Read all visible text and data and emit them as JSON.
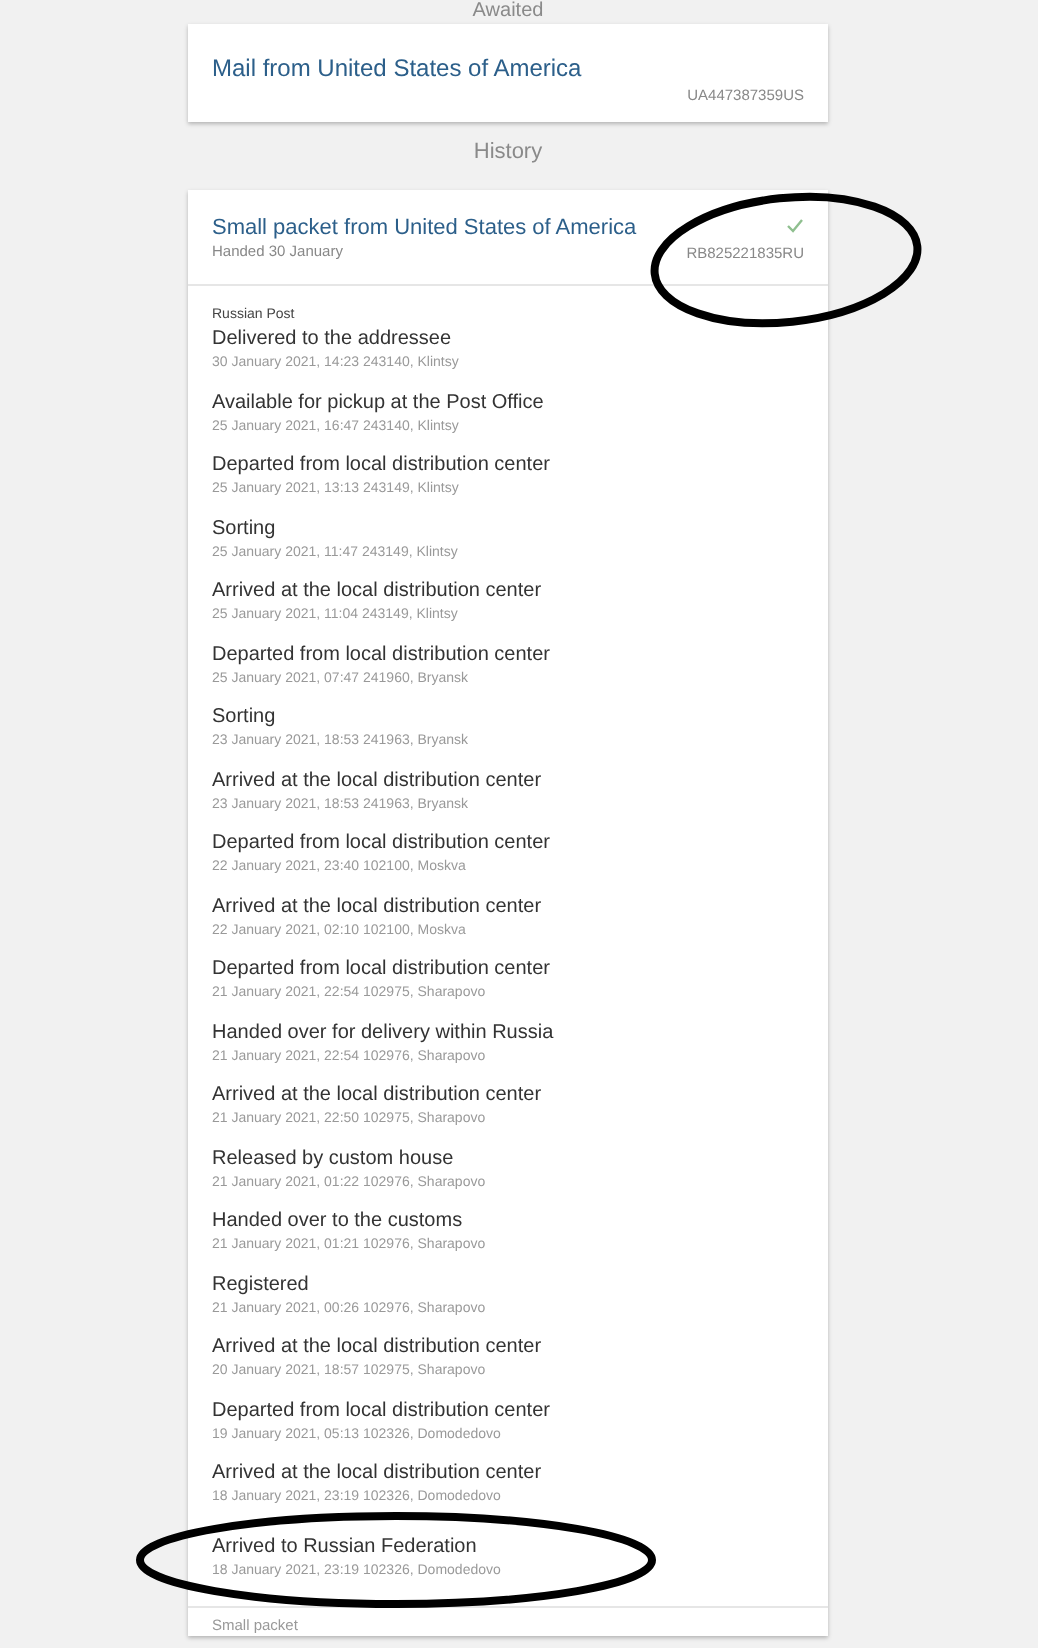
{
  "sections": [
    {
      "heading": "Awaited"
    },
    {
      "heading": "History"
    }
  ],
  "awaited": {
    "title": "Mail from United States of America",
    "track": "UA447387359US"
  },
  "history": {
    "title": "Small packet from United States of America",
    "subtitle": "Handed 30 January",
    "track": "RB825221835RU",
    "delivered": true,
    "carrier": "Russian Post",
    "events": [
      {
        "status": "Delivered to the addressee",
        "detail": "30 January 2021, 14:23 243140, Klintsy"
      },
      {
        "status": "Available for pickup at the Post Office",
        "detail": "25 January 2021, 16:47 243140, Klintsy"
      },
      {
        "status": "Departed from local distribution center",
        "detail": "25 January 2021, 13:13 243149, Klintsy"
      },
      {
        "status": "Sorting",
        "detail": "25 January 2021, 11:47 243149, Klintsy"
      },
      {
        "status": "Arrived at the local distribution center",
        "detail": "25 January 2021, 11:04 243149, Klintsy"
      },
      {
        "status": "Departed from local distribution center",
        "detail": "25 January 2021, 07:47 241960, Bryansk"
      },
      {
        "status": "Sorting",
        "detail": "23 January 2021, 18:53 241963, Bryansk"
      },
      {
        "status": "Arrived at the local distribution center",
        "detail": "23 January 2021, 18:53 241963, Bryansk"
      },
      {
        "status": "Departed from local distribution center",
        "detail": "22 January 2021, 23:40 102100, Moskva"
      },
      {
        "status": "Arrived at the local distribution center",
        "detail": "22 January 2021, 02:10 102100, Moskva"
      },
      {
        "status": "Departed from local distribution center",
        "detail": "21 January 2021, 22:54 102975, Sharapovo"
      },
      {
        "status": "Handed over for delivery within Russia",
        "detail": "21 January 2021, 22:54 102976, Sharapovo"
      },
      {
        "status": "Arrived at the local distribution center",
        "detail": "21 January 2021, 22:50 102975, Sharapovo"
      },
      {
        "status": "Released by custom house",
        "detail": "21 January 2021, 01:22 102976, Sharapovo"
      },
      {
        "status": "Handed over to the customs",
        "detail": "21 January 2021, 01:21 102976, Sharapovo"
      },
      {
        "status": "Registered",
        "detail": "21 January 2021, 00:26 102976, Sharapovo"
      },
      {
        "status": "Arrived at the local distribution center",
        "detail": "20 January 2021, 18:57 102975, Sharapovo"
      },
      {
        "status": "Departed from local distribution center",
        "detail": "19 January 2021, 05:13 102326, Domodedovo"
      },
      {
        "status": "Arrived at the local distribution center",
        "detail": "18 January 2021, 23:19 102326, Domodedovo"
      },
      {
        "status": "Arrived to Russian Federation",
        "detail": "18 January 2021, 23:19 102326, Domodedovo"
      }
    ],
    "footer": "Small packet"
  }
}
